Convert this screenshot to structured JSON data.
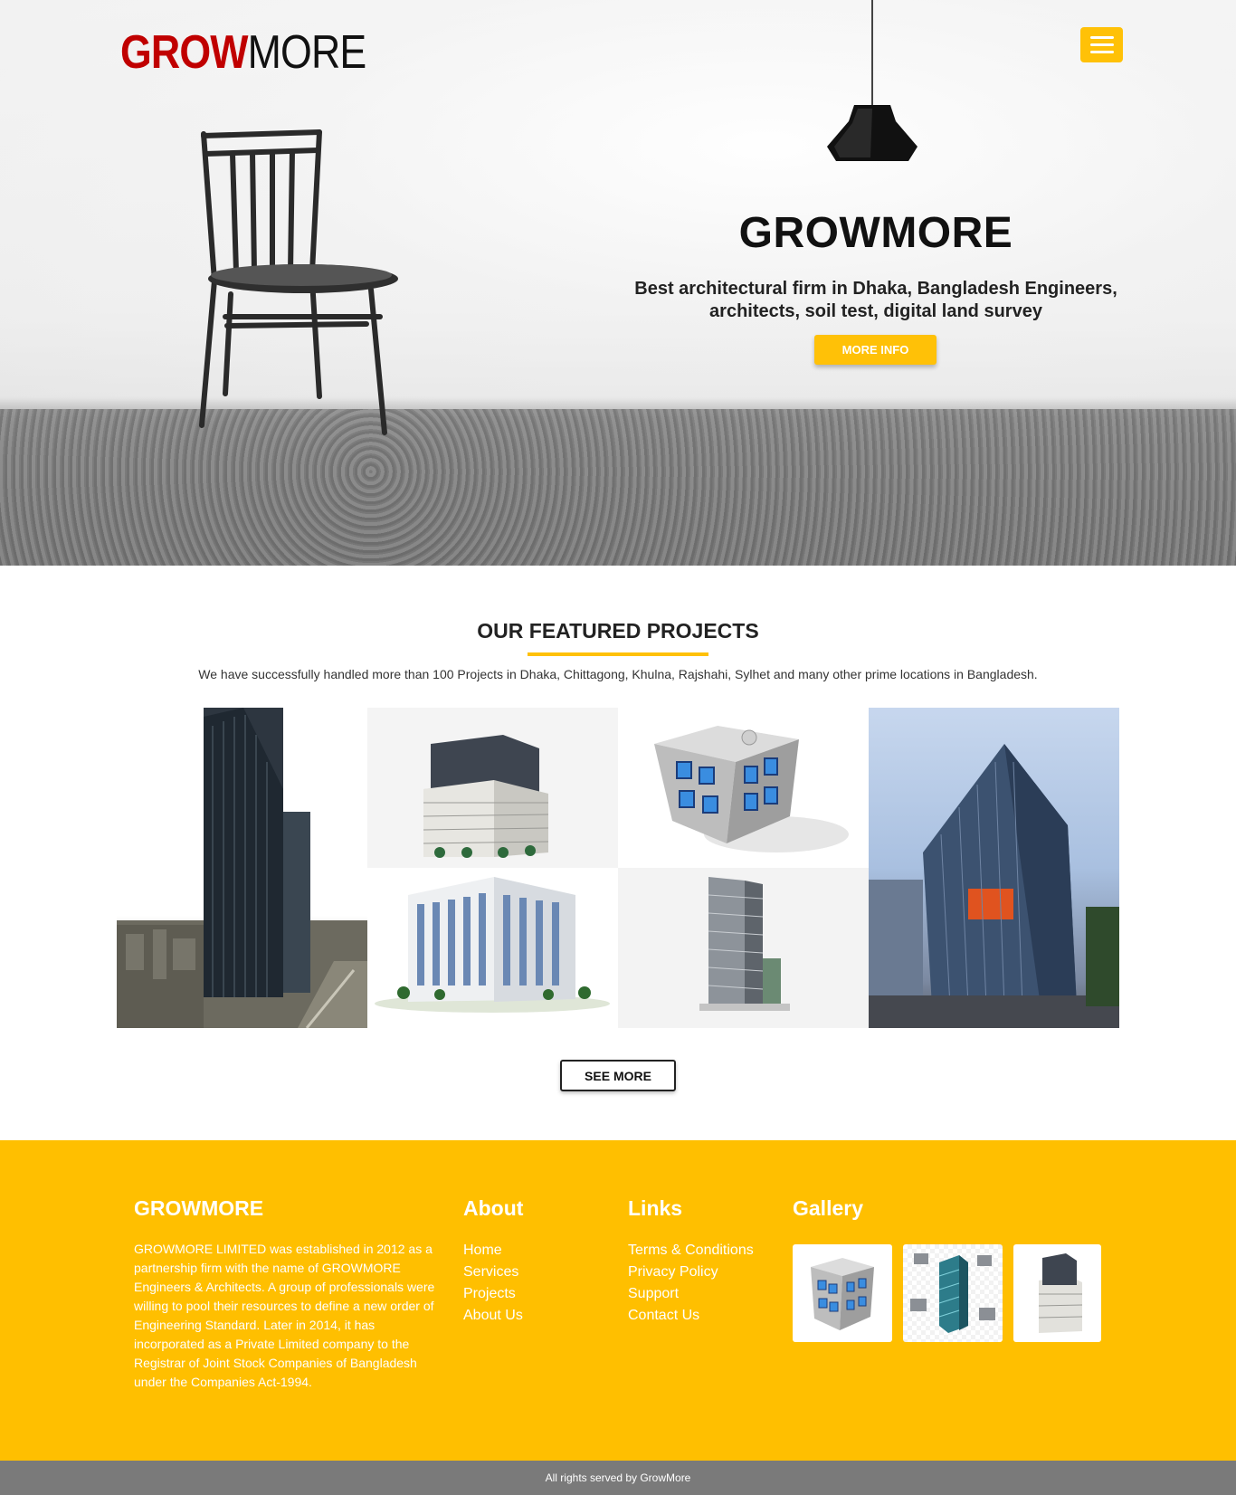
{
  "header": {
    "logo_part1": "GROW",
    "logo_part2": "MORE",
    "menu_icon": "hamburger-icon"
  },
  "hero": {
    "title": "GROWMORE",
    "subtitle": "Best architectural firm in Dhaka, Bangladesh Engineers, architects, soil test, digital land survey",
    "button_label": "MORE INFO"
  },
  "featured": {
    "title": "OUR FEATURED PROJECTS",
    "description": "We have successfully handled more than 100 Projects in Dhaka, Chittagong, Khulna, Rajshahi, Sylhet and many other prime locations in Bangladesh.",
    "see_more_label": "SEE MORE"
  },
  "footer": {
    "brand": {
      "heading": "GROWMORE",
      "text": "GROWMORE LIMITED was established in 2012 as a partnership firm with the name of GROWMORE Engineers & Architects. A group of professionals were willing to pool their resources to define a new order of Engineering Standard. Later in 2014, it has incorporated as a Private Limited company to the Registrar of Joint Stock Companies of Bangladesh under the Companies Act-1994."
    },
    "about": {
      "heading": "About",
      "items": [
        "Home",
        "Services",
        "Projects",
        "About Us"
      ]
    },
    "links": {
      "heading": "Links",
      "items": [
        "Terms & Conditions",
        "Privacy Policy",
        "Support",
        "Contact Us"
      ]
    },
    "gallery": {
      "heading": "Gallery"
    },
    "copyright": "All rights served by GrowMore"
  },
  "colors": {
    "accent": "#ffc107",
    "footer_bg": "#ffbf00",
    "logo_red": "#c00000",
    "bottom_bar": "#7a7a7a"
  }
}
